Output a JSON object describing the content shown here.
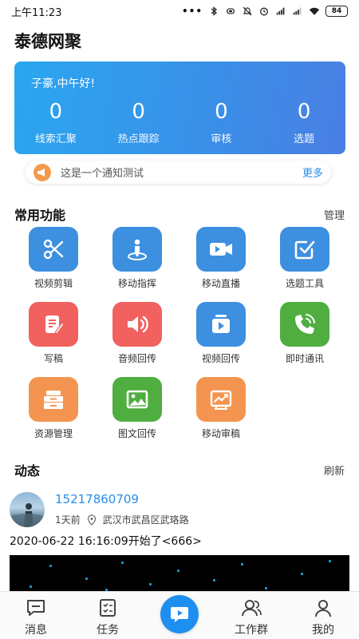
{
  "status_bar": {
    "time": "上午11:23",
    "dots": "•••",
    "battery": "84"
  },
  "app": {
    "title": "泰德网聚"
  },
  "hero": {
    "greeting": "子豪,中午好!",
    "stats": [
      {
        "value": "0",
        "label": "线索汇聚"
      },
      {
        "value": "0",
        "label": "热点跟踪"
      },
      {
        "value": "0",
        "label": "审核"
      },
      {
        "value": "0",
        "label": "选题"
      }
    ]
  },
  "notice": {
    "text": "这是一个通知测试",
    "more": "更多"
  },
  "common": {
    "title": "常用功能",
    "manage": "管理",
    "items": [
      {
        "label": "视频剪辑",
        "icon": "scissors-icon",
        "color": "#3d8fe0"
      },
      {
        "label": "移动指挥",
        "icon": "person-pin-icon",
        "color": "#3d8fe0"
      },
      {
        "label": "移动直播",
        "icon": "video-camera-icon",
        "color": "#3d8fe0"
      },
      {
        "label": "选题工具",
        "icon": "checkbox-icon",
        "color": "#3d8fe0"
      },
      {
        "label": "写稿",
        "icon": "edit-doc-icon",
        "color": "#f0615f"
      },
      {
        "label": "音频回传",
        "icon": "speaker-icon",
        "color": "#f0615f"
      },
      {
        "label": "视频回传",
        "icon": "video-upload-icon",
        "color": "#3d8fe0"
      },
      {
        "label": "即时通讯",
        "icon": "phone-icon",
        "color": "#4fae3f"
      },
      {
        "label": "资源管理",
        "icon": "drawer-icon",
        "color": "#f39550"
      },
      {
        "label": "图文回传",
        "icon": "image-icon",
        "color": "#4fae3f"
      },
      {
        "label": "移动审稿",
        "icon": "trend-chart-icon",
        "color": "#f39550"
      }
    ]
  },
  "feed": {
    "title": "动态",
    "refresh": "刷新",
    "post": {
      "name": "15217860709",
      "time": "1天前",
      "location": "武汉市武昌区武珞路",
      "text": "2020-06-22 16:16:09开始了<666>"
    }
  },
  "nav": {
    "items": [
      {
        "label": "消息",
        "icon": "message-icon"
      },
      {
        "label": "任务",
        "icon": "task-icon"
      },
      {
        "label": "",
        "icon": "center-chat-icon"
      },
      {
        "label": "工作群",
        "icon": "group-icon"
      },
      {
        "label": "我的",
        "icon": "user-icon"
      }
    ]
  },
  "colors": {
    "accent": "#2a8de8",
    "hero_start": "#2aa6f0",
    "hero_end": "#4a7fe3"
  }
}
